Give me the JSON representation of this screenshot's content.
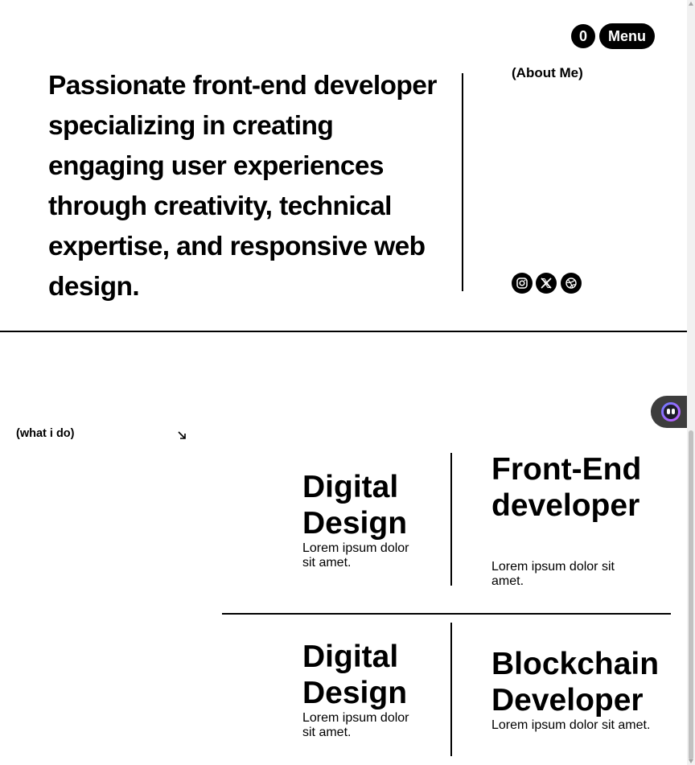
{
  "header": {
    "cart_count": "0",
    "menu_label": "Menu"
  },
  "about": {
    "label": "(About Me)",
    "text": "Passionate front-end developer specializing in creating engaging user experiences through creativity, technical expertise, and responsive web design.",
    "social_icons": [
      "instagram-icon",
      "x-icon",
      "dribbble-icon"
    ]
  },
  "services": {
    "label": "(what i do)",
    "arrow_icon": "arrow-down-right-icon",
    "items": [
      {
        "title": "Digital Design",
        "desc": "Lorem ipsum dolor sit amet."
      },
      {
        "title": "Front-End developer",
        "desc": "Lorem ipsum dolor sit amet."
      },
      {
        "title": "Digital Design",
        "desc": "Lorem ipsum dolor sit amet."
      },
      {
        "title": "Blockchain Developer",
        "desc": "Lorem ipsum dolor sit amet."
      }
    ]
  },
  "chat_widget": {
    "icon": "chatbot-icon"
  },
  "colors": {
    "text": "#000000",
    "background": "#ffffff",
    "widget": "#3d3d3d"
  }
}
